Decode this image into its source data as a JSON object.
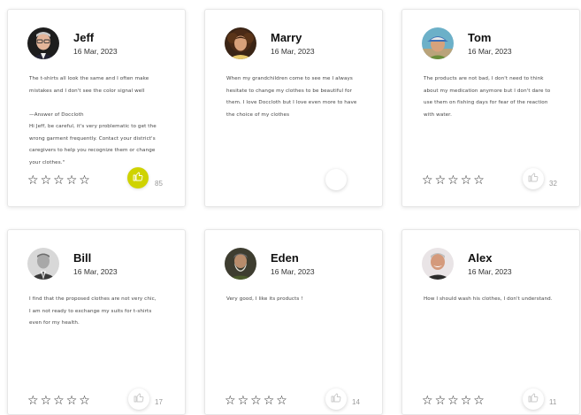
{
  "reviews": [
    {
      "name": "Jeff",
      "date": "16 Mar, 2023",
      "paragraphs": [
        "The t-shirts all look the same and I often make\nmistakes and I don't see the color signal well",
        "",
        "—Answer of Doccloth\nHi Jeff, be careful, it's very problematic to get the\nwrong garment frequently. Contact your district's\ncaregivers to help you recognize them or change\nyour clothes.\""
      ],
      "stars": 0,
      "likes": "85",
      "liked": true,
      "avatar": "avatar-man-glasses"
    },
    {
      "name": "Marry",
      "date": "16 Mar, 2023",
      "paragraphs": [
        "When my grandchildren come to see me I always\nhesitate to change my clothes to be beautiful for\nthem. I love Doccloth but I love even more to have\nthe choice of my clothes"
      ],
      "stars": 0,
      "likes": "",
      "liked": false,
      "avatar": "avatar-woman-curly"
    },
    {
      "name": "Tom",
      "date": "16 Mar, 2023",
      "paragraphs": [
        "The products are not bad, I don't need to think\nabout my medication anymore but I don't dare to\nuse them on fishing days for fear of the reaction\nwith water."
      ],
      "stars": 0,
      "likes": "32",
      "liked": false,
      "avatar": "avatar-man-cap"
    },
    {
      "name": "Bill",
      "date": "16 Mar, 2023",
      "paragraphs": [
        "I find that the proposed clothes are not very chic,\nI am not ready to exchange my suits for t-shirts\neven for my health."
      ],
      "stars": 0,
      "likes": "17",
      "liked": false,
      "avatar": "avatar-man-suit"
    },
    {
      "name": "Eden",
      "date": "16 Mar, 2023",
      "paragraphs": [
        "Very good, I like its products !"
      ],
      "stars": 0,
      "likes": "14",
      "liked": false,
      "avatar": "avatar-man-beard"
    },
    {
      "name": "Alex",
      "date": "16 Mar, 2023",
      "paragraphs": [
        "How I should wash his clothes, I don't understand."
      ],
      "stars": 0,
      "likes": "11",
      "liked": false,
      "avatar": "avatar-man-smile"
    }
  ],
  "colors": {
    "like_active": "#cfd300",
    "card_border": "#e7e7e7"
  }
}
